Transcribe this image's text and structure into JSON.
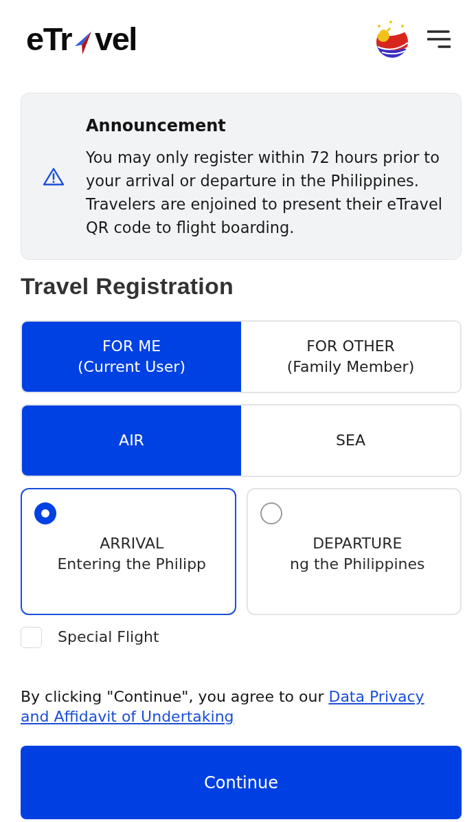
{
  "header": {
    "logo": {
      "text_before": "eTr",
      "text_after": "vel"
    }
  },
  "announcement": {
    "title": "Announcement",
    "body": "You may only register within 72 hours prior to your arrival or departure in the Philippines. Travelers are enjoined to present their eTravel QR code to flight boarding."
  },
  "heading": "Travel Registration",
  "traveler_tabs": [
    {
      "label": "FOR ME",
      "sublabel": "(Current User)",
      "selected": true
    },
    {
      "label": "FOR OTHER",
      "sublabel": "(Family Member)",
      "selected": false
    }
  ],
  "mode_tabs": [
    {
      "label": "AIR",
      "selected": true
    },
    {
      "label": "SEA",
      "selected": false
    }
  ],
  "direction_options": [
    {
      "label": "ARRIVAL",
      "description": "Entering the Philipp",
      "selected": true
    },
    {
      "label": "DEPARTURE",
      "description": "ng the Philippines",
      "selected": false
    }
  ],
  "special_flight": {
    "label": "Special Flight",
    "checked": false
  },
  "consent": {
    "text": "By clicking \"Continue\", you agree to our",
    "links": [
      "Data Privacy",
      "and Affidavit of Undertaking"
    ]
  },
  "continue_button": {
    "label": "Continue"
  }
}
